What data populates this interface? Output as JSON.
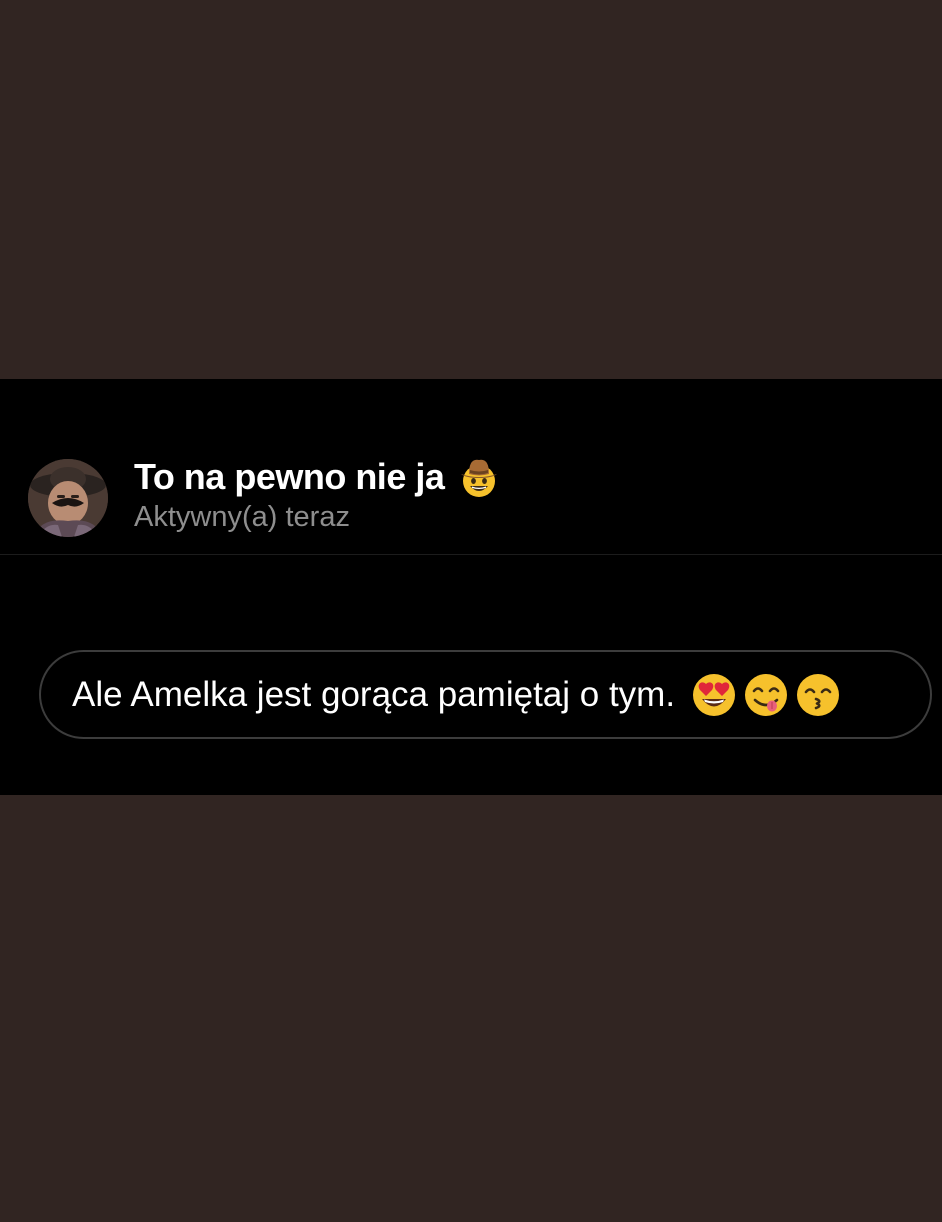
{
  "header": {
    "contact_name": "To na pewno nie ja",
    "name_emoji": "cowboy-hat-face-emoji",
    "status": "Aktywny(a) teraz",
    "avatar": "contact-avatar-photo"
  },
  "messages": [
    {
      "text": "Ale Amelka jest gorąca pamiętaj o tym.",
      "emojis": [
        "heart-eyes-emoji",
        "yum-face-emoji",
        "kissing-smiling-eyes-emoji"
      ]
    }
  ],
  "colors": {
    "page_background": "#312522",
    "chat_background": "#000000",
    "text_primary": "#ffffff",
    "text_secondary": "#8e8e8e",
    "bubble_border": "#3c3c3c"
  }
}
